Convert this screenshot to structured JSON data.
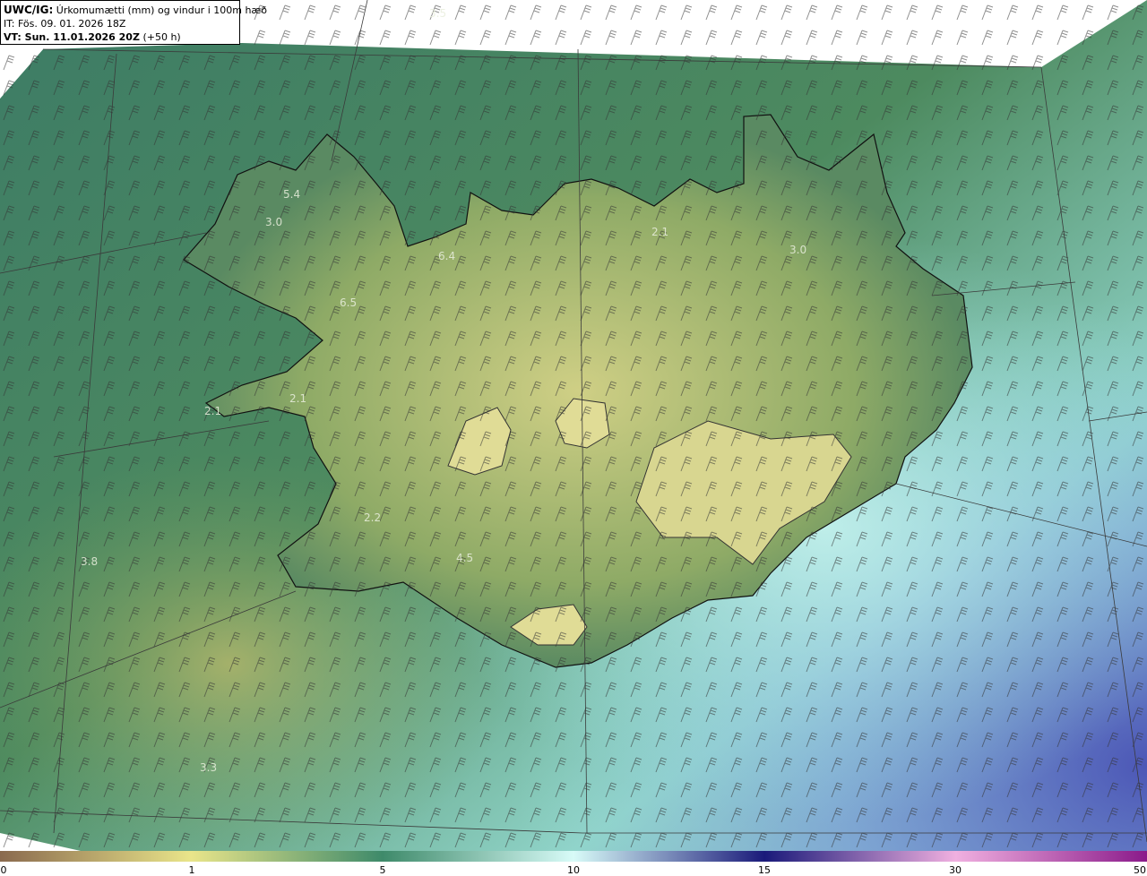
{
  "header": {
    "product": "UWC/IG:",
    "description": "Úrkomumætti (mm) og vindur i 100m hæð",
    "initial_time": "IT: Fös. 09. 01. 2026 18Z",
    "valid_time_label": "VT: Sun. 11.01.2026 20Z",
    "valid_time_offset": "(+50 h)"
  },
  "value_labels": [
    "3.5",
    "5.4",
    "3.0",
    "6.4",
    "6.5",
    "2.1",
    "3.0",
    "2.1",
    "2.2",
    "3.8",
    "4.5",
    "3.3",
    "2.1"
  ],
  "colorbar": {
    "ticks": [
      "0",
      "1",
      "5",
      "10",
      "15",
      "30",
      "50"
    ],
    "colors": [
      "#8a6a4e",
      "#e9e58a",
      "#3e8a6a",
      "#d8fbf8",
      "#1a1a7a",
      "#f0b0e0",
      "#8a1a8a"
    ]
  },
  "map": {
    "land_color": "#a6b46c",
    "sea_color": "#4a7a63",
    "high_precip_color": "#b8ecea",
    "grid_line_color": "#3a3a3a"
  }
}
